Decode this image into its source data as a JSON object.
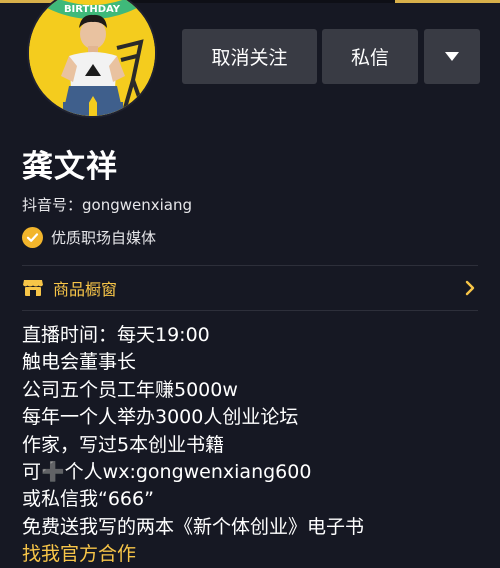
{
  "profile": {
    "avatar_badge_text": "BIRTHDAY",
    "name": "龚文祥",
    "douyin_id": "抖音号：gongwenxiang",
    "verified_label": "优质职场自媒体"
  },
  "actions": {
    "unfollow_label": "取消关注",
    "message_label": "私信",
    "more_icon": "triangle-down-icon"
  },
  "shop": {
    "label": "商品橱窗",
    "icon": "storefront-icon",
    "accent": "#f7c548"
  },
  "bio": {
    "lines": [
      "直播时间：每天19:00",
      "触电会董事长",
      "公司五个员工年赚5000w",
      "每年一个人举办3000人创业论坛",
      "作家，写过5本创业书籍",
      "可➕个人wx:gongwenxiang600",
      "或私信我“666”",
      "免费送我写的两本《新个体创业》电子书"
    ],
    "link_text": "找我官方合作"
  },
  "colors": {
    "background": "#161823",
    "button": "#393b44",
    "accent": "#f7c548",
    "verified_badge": "#f2b52c"
  }
}
